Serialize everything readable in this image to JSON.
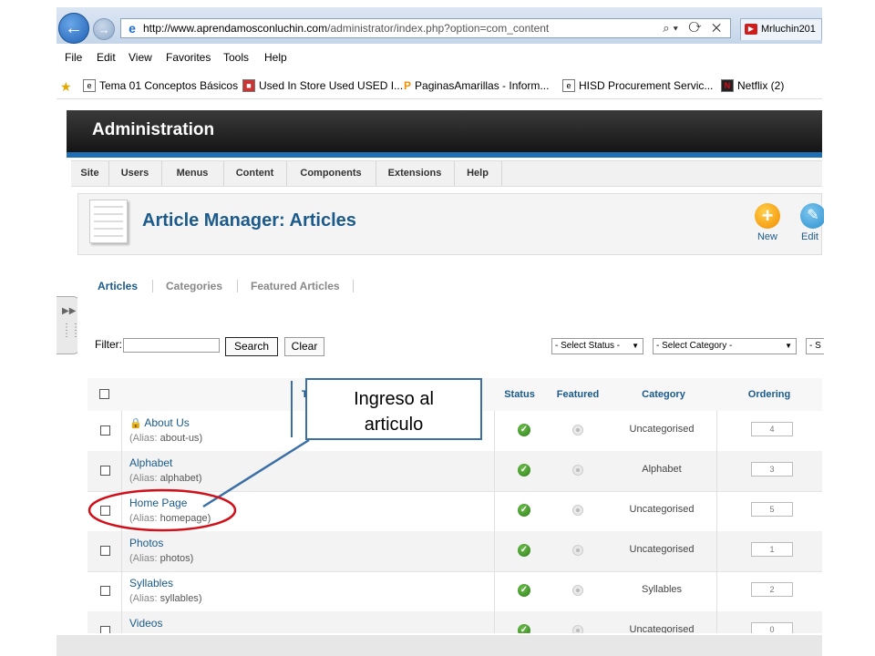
{
  "browser": {
    "address_url_host": "http://www.aprendamosconluchin.com",
    "address_url_path": "/administrator/index.php?option=com_content",
    "address_tools": "⌕▾ ⟳ ✕",
    "tab_label": "Mrluchin201",
    "menu": [
      "File",
      "Edit",
      "View",
      "Favorites",
      "Tools",
      "Help"
    ],
    "favorites": [
      {
        "label": "Tema 01 Conceptos Básicos",
        "icon": "page-icon"
      },
      {
        "label": "Used In Store Used USED I...",
        "icon": "store-icon"
      },
      {
        "label": "PaginasAmarillas - Inform...",
        "icon": "pin-icon"
      },
      {
        "label": "HISD  Procurement Servic...",
        "icon": "page-icon"
      },
      {
        "label": "Netflix (2)",
        "icon": "netflix-icon"
      }
    ]
  },
  "admin": {
    "title": "Administration",
    "menu": [
      "Site",
      "Users",
      "Menus",
      "Content",
      "Components",
      "Extensions",
      "Help"
    ],
    "page_title": "Article Manager: Articles",
    "toolbar": {
      "new_label": "New",
      "edit_label": "Edit"
    },
    "submenu": [
      "Articles",
      "Categories",
      "Featured Articles"
    ],
    "filter": {
      "label": "Filter:",
      "value": "",
      "search_label": "Search",
      "clear_label": "Clear",
      "status_select": "- Select Status -",
      "category_select": "- Select Category -",
      "third_select": "- S"
    },
    "table": {
      "headers": {
        "title": "Tit",
        "status": "Status",
        "featured": "Featured",
        "category": "Category",
        "ordering": "Ordering"
      },
      "alias_prefix": "(Alias: ",
      "rows": [
        {
          "title": "About Us",
          "alias": "about-us",
          "category": "Uncategorised",
          "ordering": "4",
          "locked": true
        },
        {
          "title": "Alphabet",
          "alias": "alphabet",
          "category": "Alphabet",
          "ordering": "3",
          "locked": false
        },
        {
          "title": "Home Page",
          "alias": "homepage",
          "category": "Uncategorised",
          "ordering": "5",
          "locked": false
        },
        {
          "title": "Photos",
          "alias": "photos",
          "category": "Uncategorised",
          "ordering": "1",
          "locked": false
        },
        {
          "title": "Syllables",
          "alias": "syllables",
          "category": "Syllables",
          "ordering": "2",
          "locked": false
        },
        {
          "title": "Videos",
          "alias": "",
          "category": "Uncategorised",
          "ordering": "0",
          "locked": false
        }
      ]
    }
  },
  "annotation": {
    "callout_line1": "Ingreso al",
    "callout_line2": "articulo",
    "highlight_color": "#d0101a",
    "arrow_color": "#3c6fa6"
  }
}
